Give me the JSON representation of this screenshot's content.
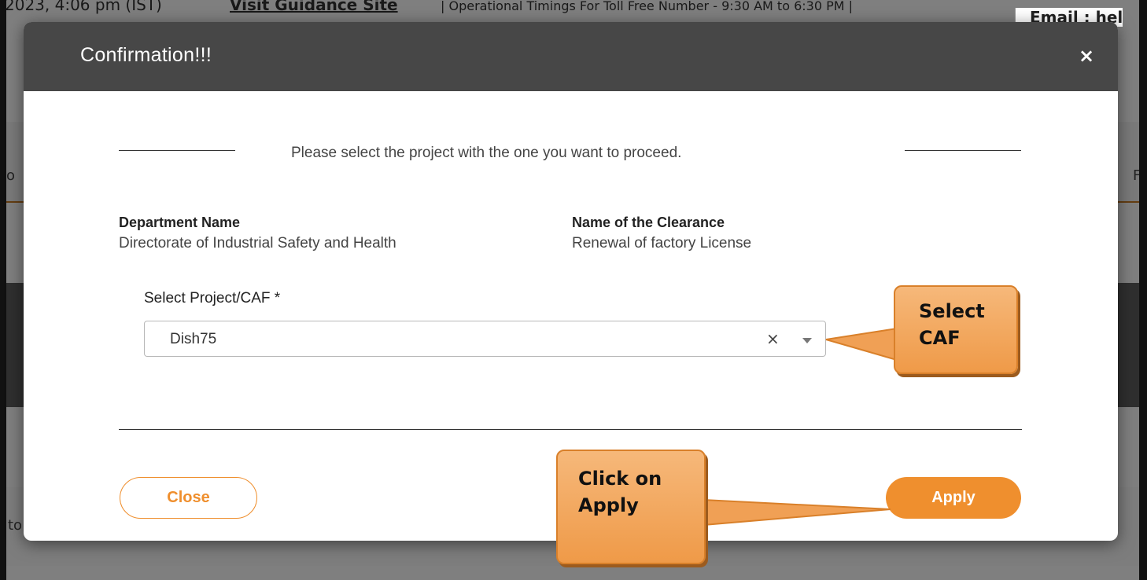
{
  "background": {
    "date_fragment": "2023, 4:06 pm (IST)",
    "guidance_link": "Visit Guidance Site",
    "timings_fragment": "| Operational Timings For Toll Free Number - 9:30 AM to 6:30 PM |",
    "email_fragment": "Email : hel",
    "left_tab_fragment": "o",
    "right_tab_fragment": "F",
    "lower_left_fragment": "to"
  },
  "modal": {
    "title": "Confirmation!!!",
    "close_icon": "×",
    "instruction": "Please select the project with the one you want to proceed.",
    "department_label": "Department Name",
    "department_value": "Directorate of Industrial Safety and Health",
    "clearance_label": "Name of the Clearance",
    "clearance_value": "Renewal of factory License",
    "select_label": "Select Project/CAF *",
    "select_value": "Dish75",
    "clear_icon": "×",
    "close_button": "Close",
    "apply_button": "Apply"
  },
  "callouts": {
    "select_caf": "Select\nCAF",
    "click_apply": "Click on\nApply"
  },
  "colors": {
    "header": "#474747",
    "accent": "#ef8f2e",
    "callout": "#f4a85f"
  }
}
